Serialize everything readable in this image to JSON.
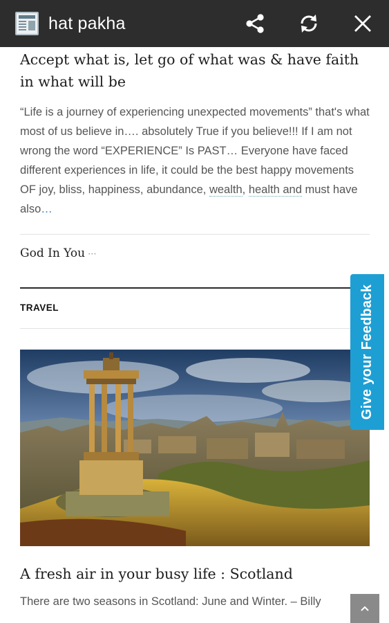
{
  "appbar": {
    "title": "hat pakha",
    "icons": [
      "newspaper-icon",
      "share-icon",
      "refresh-icon",
      "close-icon"
    ]
  },
  "post1": {
    "title": "Accept what is, let go of what was & have faith in what will be",
    "excerpt_1": "“Life is a journey of experiencing unexpected movements” that's what most of us believe in…. absolutely True if you believe!!! If I am not wrong the word “EXPERIENCE” Is PAST… Everyone have faced different experiences in life, it could be the best happy movements OF joy, bliss, happiness, abundance, ",
    "excerpt_link_1": "wealth",
    "excerpt_sep": ", ",
    "excerpt_link_2": "health and",
    "excerpt_2": " must have also",
    "excerpt_more": "…",
    "author": "God In You",
    "author_more": "···"
  },
  "section": {
    "label": "TRAVEL"
  },
  "post2": {
    "title": "A fresh air in your busy life : Scotland",
    "excerpt": "There are two seasons in Scotland: June and Winter. – Billy"
  },
  "feedback": {
    "label": "Give your Feedback"
  },
  "colors": {
    "appbar_bg": "#2d2d2d",
    "feedback_bg": "#1e9fd4",
    "link": "#2a7ac8"
  }
}
